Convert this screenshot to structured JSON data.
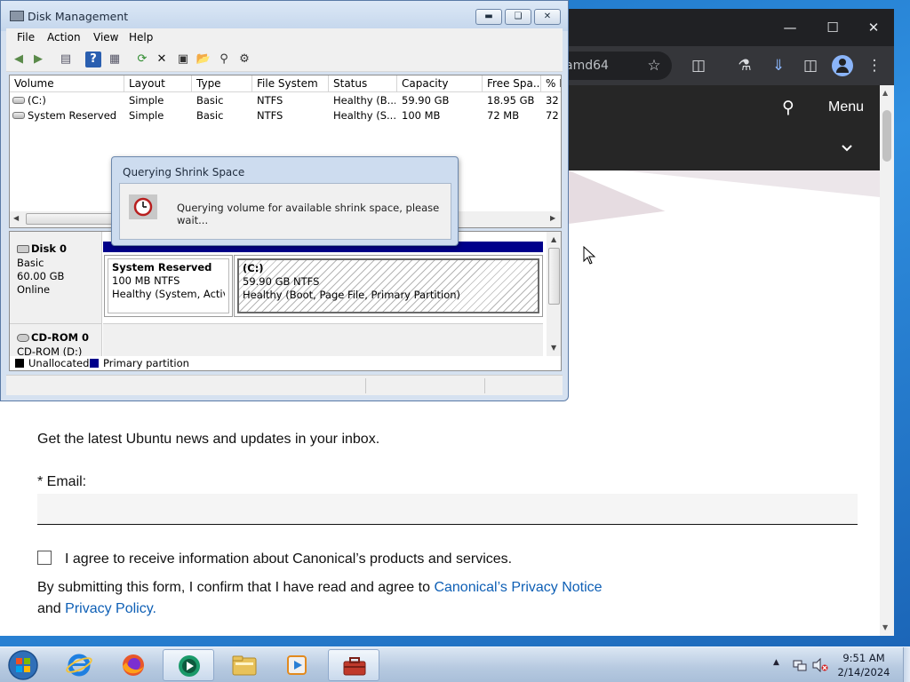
{
  "browser": {
    "omnibox_text": "amd64",
    "nav_menu": "Menu",
    "newsletter_text": "Get the latest Ubuntu news and updates in your inbox.",
    "email_label": "* Email:",
    "agree_label": "I agree to receive information about Canonical’s products and services.",
    "submit_text": "By submitting this form, I confirm that I have read and agree to",
    "privacy_notice_link": "Canonical’s Privacy Notice",
    "and_text": "and",
    "privacy_policy_link": "Privacy Policy",
    "period": "."
  },
  "disk_management": {
    "title": "Disk Management",
    "menu": [
      "File",
      "Action",
      "View",
      "Help"
    ],
    "columns": [
      "Volume",
      "Layout",
      "Type",
      "File System",
      "Status",
      "Capacity",
      "Free Spa...",
      "% F"
    ],
    "volumes": [
      {
        "volume": "(C:)",
        "layout": "Simple",
        "type": "Basic",
        "fs": "NTFS",
        "status": "Healthy (B...",
        "capacity": "59.90 GB",
        "free": "18.95 GB",
        "pct": "32"
      },
      {
        "volume": "System Reserved",
        "layout": "Simple",
        "type": "Basic",
        "fs": "NTFS",
        "status": "Healthy (S...",
        "capacity": "100 MB",
        "free": "72 MB",
        "pct": "72"
      }
    ],
    "disk0": {
      "name": "Disk 0",
      "type": "Basic",
      "size": "60.00 GB",
      "state": "Online",
      "partitions": [
        {
          "name": "System Reserved",
          "size": "100 MB NTFS",
          "status": "Healthy (System, Active,"
        },
        {
          "name": "(C:)",
          "size": "59.90 GB NTFS",
          "status": "Healthy (Boot, Page File, Primary Partition)"
        }
      ]
    },
    "cdrom": {
      "name": "CD-ROM 0",
      "drive": "CD-ROM (D:)"
    },
    "legend": [
      "Unallocated",
      "Primary partition"
    ],
    "colors": {
      "unallocated": "#000000",
      "primary_partition": "#00008b"
    }
  },
  "dialog": {
    "title": "Querying Shrink Space",
    "message": "Querying volume for available shrink space, please wait..."
  },
  "taskbar": {
    "time": "9:51 AM",
    "date": "2/14/2024"
  }
}
